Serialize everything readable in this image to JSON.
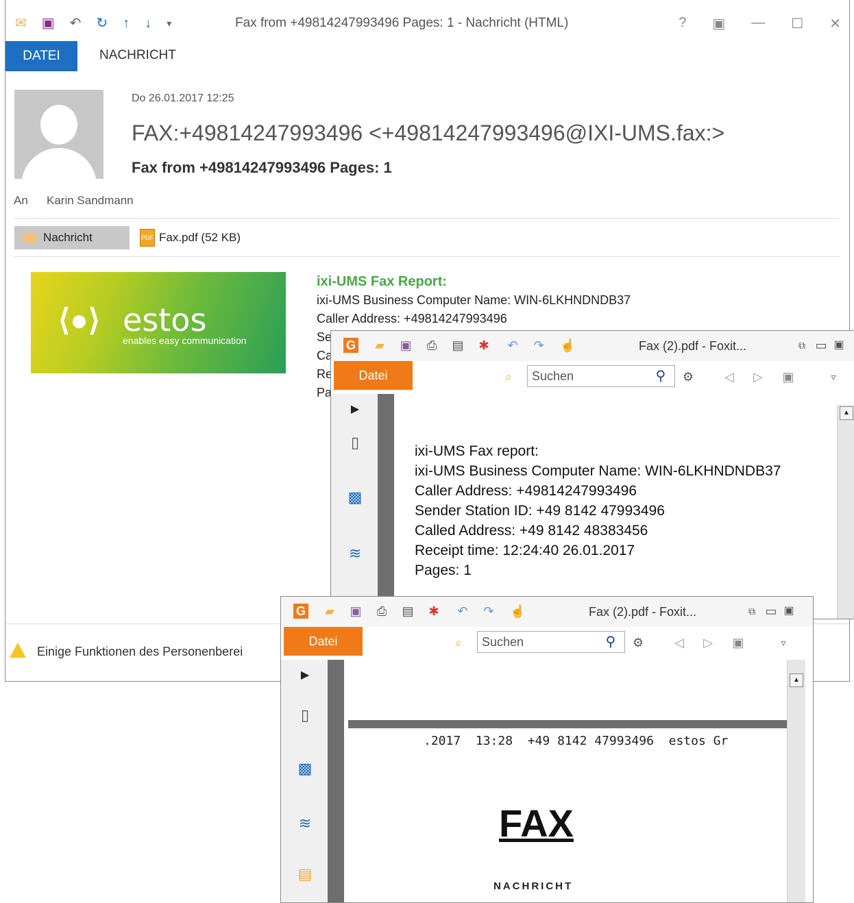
{
  "outlook": {
    "title": "Fax from +49814247993496 Pages: 1 - Nachricht (HTML)",
    "tabs": [
      "DATEI",
      "NACHRICHT"
    ],
    "date": "Do 26.01.2017 12:25",
    "sender": "FAX:+49814247993496 <+49814247993496@IXI-UMS.fax:>",
    "subject": "Fax from +49814247993496 Pages: 1",
    "to_label": "An",
    "to_name": "Karin Sandmann",
    "attachment_message": "Nachricht",
    "attachment_pdf": "Fax.pdf (52 KB)",
    "logo": {
      "word": "estos",
      "tagline": "enables easy communication"
    },
    "report": {
      "title": "ixi-UMS Fax Report:",
      "lines": [
        "ixi-UMS Business Computer Name: WIN-6LKHNDNDB37",
        "Caller Address: +49814247993496",
        "Se",
        "Ca",
        "Re",
        "Pa"
      ]
    },
    "warning": "Einige Funktionen des Personenberei"
  },
  "foxit1": {
    "title": "Fax (2).pdf - Foxit...",
    "datei": "Datei",
    "search_placeholder": "Suchen",
    "content": [
      "ixi-UMS Fax report:",
      "ixi-UMS Business Computer Name: WIN-6LKHNDNDB37",
      "Caller Address: +49814247993496",
      "Sender Station ID: +49 8142 47993496",
      "Called Address: +49 8142 48383456",
      "Receipt time: 12:24:40 26.01.2017",
      "Pages: 1"
    ]
  },
  "foxit2": {
    "title": "Fax (2).pdf - Foxit...",
    "datei": "Datei",
    "search_placeholder": "Suchen",
    "header_line": ".2017  13:28  +49 8142 47993496  estos Gr",
    "fax_heading": "FAX",
    "nachricht": "NACHRICHT"
  },
  "colors": {
    "outlook_accent": "#1e6fc4",
    "foxit_accent": "#f07a17",
    "report_green": "#49a845"
  }
}
